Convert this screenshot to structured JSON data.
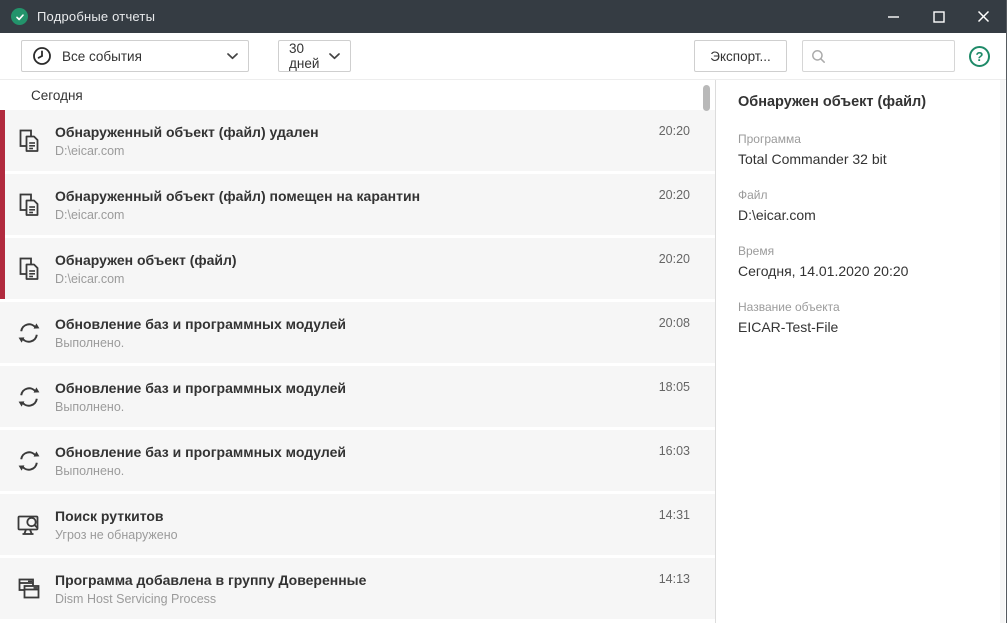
{
  "window": {
    "title": "Подробные отчеты"
  },
  "colors": {
    "titlebar_bg": "#353c43",
    "brand_green": "#23936b",
    "help_green": "#1e8a68",
    "danger_stripe": "#b12a3e",
    "row_bg": "#f6f6f6"
  },
  "icons": {
    "app": "shield-check-icon",
    "window_controls": [
      "minimize-icon",
      "maximize-icon",
      "close-icon"
    ],
    "events_filter": "clock-icon",
    "dropdown_arrow": "chevron-down-icon",
    "search": "magnifier-icon",
    "help": "question-circle-icon"
  },
  "toolbar": {
    "events_filter_value": "Все события",
    "period_filter_value": "30 дней",
    "export_label": "Экспорт...",
    "search_placeholder": "",
    "help_label": "?"
  },
  "list": {
    "section": "Сегодня",
    "rows": [
      {
        "title": "Обнаруженный объект (файл) удален",
        "subtitle": "D:\\eicar.com",
        "time": "20:20",
        "icon": "file-copy-icon",
        "severity": "danger"
      },
      {
        "title": "Обнаруженный объект (файл) помещен на карантин",
        "subtitle": "D:\\eicar.com",
        "time": "20:20",
        "icon": "file-copy-icon",
        "severity": "danger"
      },
      {
        "title": "Обнаружен объект (файл)",
        "subtitle": "D:\\eicar.com",
        "time": "20:20",
        "icon": "file-copy-icon",
        "severity": "danger"
      },
      {
        "title": "Обновление баз и программных модулей",
        "subtitle": "Выполнено.",
        "time": "20:08",
        "icon": "refresh-icon",
        "severity": "info"
      },
      {
        "title": "Обновление баз и программных модулей",
        "subtitle": "Выполнено.",
        "time": "18:05",
        "icon": "refresh-icon",
        "severity": "info"
      },
      {
        "title": "Обновление баз и программных модулей",
        "subtitle": "Выполнено.",
        "time": "16:03",
        "icon": "refresh-icon",
        "severity": "info"
      },
      {
        "title": "Поиск руткитов",
        "subtitle": "Угроз не обнаружено",
        "time": "14:31",
        "icon": "rootkit-scan-icon",
        "severity": "info"
      },
      {
        "title": "Программа добавлена в группу Доверенные",
        "subtitle": "Dism Host Servicing Process",
        "time": "14:13",
        "icon": "app-windows-icon",
        "severity": "info"
      }
    ]
  },
  "details": {
    "title": "Обнаружен объект (файл)",
    "fields": [
      {
        "label": "Программа",
        "value": "Total Commander 32 bit"
      },
      {
        "label": "Файл",
        "value": "D:\\eicar.com"
      },
      {
        "label": "Время",
        "value": "Сегодня, 14.01.2020 20:20"
      },
      {
        "label": "Название объекта",
        "value": "EICAR-Test-File"
      }
    ]
  }
}
